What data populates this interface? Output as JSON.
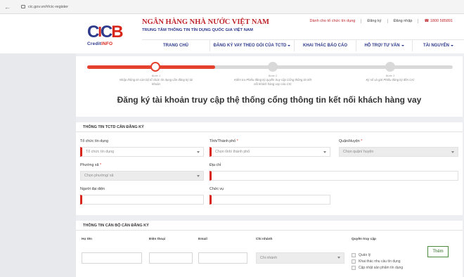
{
  "browser": {
    "url": "cic.gov.vn/#/cic-register"
  },
  "header": {
    "logo": {
      "mark": [
        "C",
        "I",
        "C",
        "B"
      ],
      "brand_a": "Credit",
      "brand_b": "INFO"
    },
    "bank_name": "NGÂN HÀNG NHÀ NƯỚC VIỆT NAM",
    "bank_subtitle": "TRUNG TÂM THÔNG TIN TÍN DỤNG QUỐC GIA VIỆT NAM",
    "top_links": {
      "tctd": "Dành cho tổ chức tín dụng",
      "register": "Đăng ký",
      "login": "Đăng nhập",
      "phone": "1800 585891"
    },
    "nav": [
      {
        "label": "TRANG CHỦ",
        "dropdown": false
      },
      {
        "label": "ĐĂNG KÝ VAY THEO GÓI CỦA TCTD",
        "dropdown": true
      },
      {
        "label": "KHAI THÁC BÁO CÁO",
        "dropdown": false
      },
      {
        "label": "HỖ TRỢ/ TƯ VẤN",
        "dropdown": true
      },
      {
        "label": "TÀI NGUYÊN",
        "dropdown": true
      }
    ]
  },
  "steps": {
    "progress": 0.35,
    "items": [
      {
        "num": "Bước 1",
        "text": "Nhập thông tin cán bộ tổ chức tín dụng cần đăng ký tài khoản"
      },
      {
        "num": "Bước 2",
        "text": "Kiểm tra Phiếu đăng ký quyền truy cập Cổng thông tin kết nối khách hàng vay của CIC"
      },
      {
        "num": "Bước 3",
        "text": "Ký số và gửi Phiếu đăng ký đến CIC"
      }
    ]
  },
  "page_title": "Đăng ký tài khoản truy cập thệ thống cổng thông tin kết nối khách hàng vay",
  "section1": {
    "title": "THÔNG TIN TCTD CẦN ĐĂNG KÝ",
    "to_chuc": {
      "label": "Tổ chức tín dụng",
      "placeholder": "Tổ chức tín dụng"
    },
    "tinh": {
      "label": "Tỉnh/Thành phố",
      "placeholder": "Chọn tỉnh/ thành phố"
    },
    "quan": {
      "label": "Quận/Huyện",
      "placeholder": "Chọn quận/ huyện"
    },
    "phuong": {
      "label": "Phường xã",
      "placeholder": "Chọn phường/ xã"
    },
    "dia_chi": {
      "label": "Địa chỉ",
      "value": ""
    },
    "nguoi_dai_dien": {
      "label": "Người đại diện",
      "value": ""
    },
    "chuc_vu": {
      "label": "Chức vụ",
      "value": ""
    }
  },
  "section2": {
    "title": "THÔNG TIN CÁN BỘ CẦN ĐĂNG KÝ",
    "columns": {
      "ho_ten": "Họ tên",
      "dien_thoai": "Điện thoại",
      "email": "Email",
      "chi_nhanh": "Chi nhánh",
      "quyen": "Quyền truy cập"
    },
    "chi_nhanh_placeholder": "Chi nhánh",
    "permissions": [
      "Quản lý",
      "Khai thác nhu cầu tín dụng",
      "Cập nhật sản phẩm tín dụng"
    ],
    "add_button": "Thêm"
  }
}
